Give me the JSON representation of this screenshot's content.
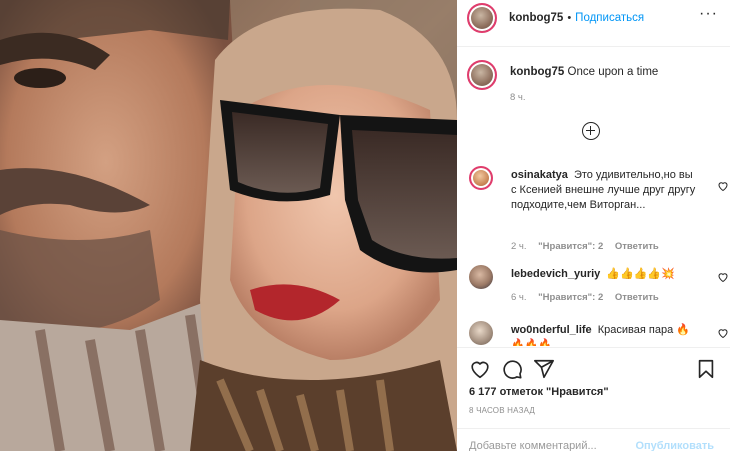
{
  "header": {
    "username": "konbog75",
    "separator": "•",
    "follow_label": "Подписаться",
    "more_label": "···"
  },
  "caption": {
    "username": "konbog75",
    "text": "Once upon a time",
    "time": "8 ч."
  },
  "load_more_icon": "plus-circle-icon",
  "comments": [
    {
      "username": "osinakatya",
      "text": "Это удивительно,но вы с Ксенией внешне лучше друг другу подходите,чем Виторган...",
      "time": "2 ч.",
      "likes": "\"Нравится\": 2",
      "reply": "Ответить"
    },
    {
      "username": "lebedevich_yuriy",
      "text": "👍👍👍👍💥",
      "time": "6 ч.",
      "likes": "\"Нравится\": 2",
      "reply": "Ответить"
    },
    {
      "username": "wo0nderful_life",
      "text": "Красивая пара 🔥🔥🔥🔥"
    }
  ],
  "actions": {
    "like_icon": "heart-icon",
    "comment_icon": "comment-icon",
    "share_icon": "paper-plane-icon",
    "save_icon": "bookmark-icon"
  },
  "likes_count": "6 177 отметок \"Нравится\"",
  "post_time": "8 ЧАСОВ НАЗАД",
  "add_comment": {
    "placeholder": "Добавьте комментарий...",
    "publish_label": "Опубликовать"
  },
  "colors": {
    "link_blue": "#0095f6",
    "muted": "#8e8e8e",
    "story_ring": "#e03c6d",
    "publish_disabled": "#b2dffc"
  }
}
